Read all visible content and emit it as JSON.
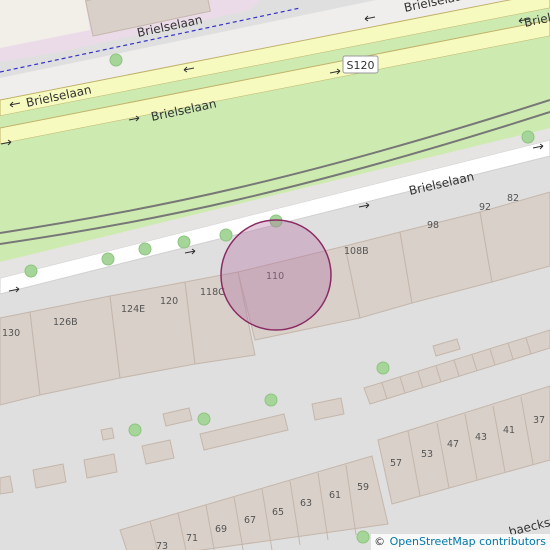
{
  "map": {
    "street_labels": [
      {
        "id": "top",
        "text": "Brielselaan"
      },
      {
        "id": "upper-left",
        "text": "Brielselaan"
      },
      {
        "id": "upper-right",
        "text": "Brielselaan"
      },
      {
        "id": "upper-far-right",
        "text": "Briel"
      },
      {
        "id": "middle",
        "text": "Brielselaan"
      },
      {
        "id": "lower",
        "text": "Brielselaan"
      },
      {
        "id": "bottom-right",
        "text": "baeckst"
      }
    ],
    "route_shield": "S120",
    "house_numbers": {
      "hn_130": "130",
      "hn_126b": "126B",
      "hn_124e": "124E",
      "hn_120": "120",
      "hn_118c": "118C",
      "hn_110": "110",
      "hn_108b": "108B",
      "hn_98": "98",
      "hn_92": "92",
      "hn_82": "82",
      "hn_57": "57",
      "hn_53": "53",
      "hn_47": "47",
      "hn_43": "43",
      "hn_41": "41",
      "hn_37": "37",
      "hn_59": "59",
      "hn_61": "61",
      "hn_63": "63",
      "hn_65": "65",
      "hn_67": "67",
      "hn_69": "69",
      "hn_71": "71",
      "hn_73": "73"
    },
    "colors": {
      "grass": "#cdebb0",
      "road_primary": "#f7fabf",
      "road_residential": "#ffffff",
      "building": "#d9d0c9",
      "building_stroke": "#c4b6ab",
      "land": "#e0dfdf",
      "tree": "#a6d59a",
      "marker_fill": "#b06ea0",
      "marker_stroke": "#8a2b64",
      "tram": "#6a6a6a",
      "boundary": "#3333cc"
    }
  },
  "attribution": {
    "copyright_symbol": "©",
    "link_text": "OpenStreetMap contributors"
  }
}
